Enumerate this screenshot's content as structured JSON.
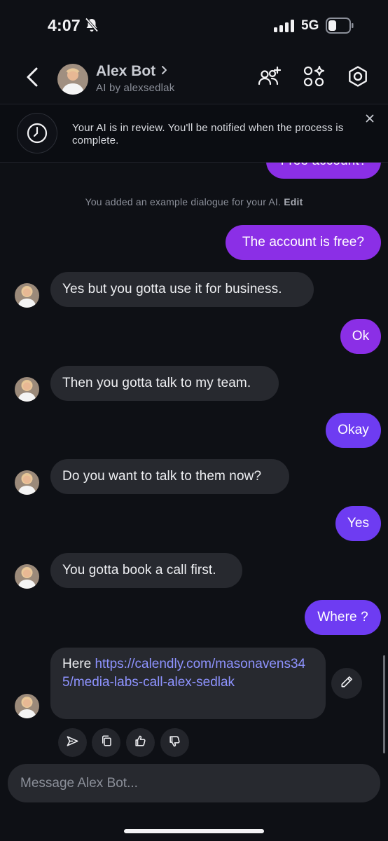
{
  "status_bar": {
    "time": "4:07",
    "network": "5G"
  },
  "header": {
    "bot_name": "Alex Bot",
    "bot_subtitle": "AI by alexsedlak"
  },
  "banner": {
    "text": "Your AI is in review. You'll be notified when the process is complete."
  },
  "messages": {
    "partial_user": "Free account?",
    "system_note": "You added an example dialogue for your AI.",
    "system_note_action": "Edit",
    "m1": "The account is free?",
    "m2": "Yes but you gotta use it for business.",
    "m3": "Ok",
    "m4": "Then you gotta talk to my team.",
    "m5": "Okay",
    "m6": "Do you want to talk to them now?",
    "m7": "Yes",
    "m8": "You gotta book a call first.",
    "m9": "Where ?",
    "m10_prefix": "Here ",
    "m10_link": "https://calendly.com/masonavens345/media-labs-call-alex-sedlak"
  },
  "composer": {
    "placeholder": "Message Alex Bot..."
  },
  "colors": {
    "background": "#0e1015",
    "bot_bubble": "#27292f",
    "user_bubble_purple": "#8b2fe6",
    "user_bubble_violet": "#6e3cf2",
    "link": "#8e93ff"
  },
  "icons": [
    "bell-off-icon",
    "signal-icon",
    "battery-icon",
    "back-chevron-icon",
    "chevron-right-icon",
    "add-people-icon",
    "apps-sparkle-icon",
    "settings-icon",
    "clock-icon",
    "close-icon",
    "pencil-icon",
    "send-icon",
    "copy-icon",
    "thumbs-up-icon",
    "thumbs-down-icon"
  ]
}
